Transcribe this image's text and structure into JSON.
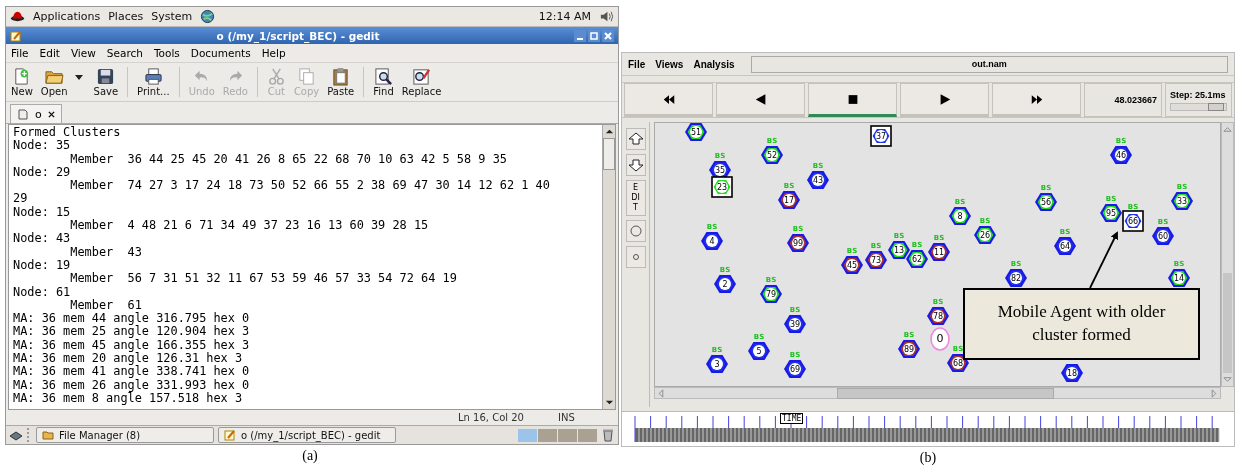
{
  "figure_a": {
    "top_panel": {
      "menus": [
        "Applications",
        "Places",
        "System"
      ],
      "clock": "12:14 AM"
    },
    "window": {
      "title": "o (/my_1/script_BEC) - gedit"
    },
    "menu_bar": [
      "File",
      "Edit",
      "View",
      "Search",
      "Tools",
      "Documents",
      "Help"
    ],
    "toolbar": [
      {
        "kind": "new",
        "label": "New",
        "disabled": false
      },
      {
        "kind": "open",
        "label": "Open",
        "disabled": false
      },
      {
        "kind": "dropdown",
        "disabled": false
      },
      {
        "kind": "save",
        "label": "Save",
        "disabled": false
      },
      {
        "kind": "separator"
      },
      {
        "kind": "print",
        "label": "Print...",
        "disabled": false
      },
      {
        "kind": "separator"
      },
      {
        "kind": "undo",
        "label": "Undo",
        "disabled": true
      },
      {
        "kind": "redo",
        "label": "Redo",
        "disabled": true
      },
      {
        "kind": "separator"
      },
      {
        "kind": "cut",
        "label": "Cut",
        "disabled": true
      },
      {
        "kind": "copy",
        "label": "Copy",
        "disabled": true
      },
      {
        "kind": "paste",
        "label": "Paste",
        "disabled": false
      },
      {
        "kind": "separator"
      },
      {
        "kind": "find",
        "label": "Find",
        "disabled": false
      },
      {
        "kind": "replace",
        "label": "Replace",
        "disabled": false
      }
    ],
    "tabs": [
      {
        "label": "o",
        "selected": true
      }
    ],
    "editor_lines": [
      "Formed Clusters",
      "Node: 35",
      "\tMember  36 44 25 45 20 41 26 8 65 22 68 70 10 63 42 5 58 9 35",
      "Node: 29",
      "\tMember  74 27 3 17 24 18 73 50 52 66 55 2 38 69 47 30 14 12 62 1 40",
      "29",
      "Node: 15",
      "\tMember  4 48 21 6 71 34 49 37 23 16 13 60 39 28 15",
      "Node: 43",
      "\tMember  43",
      "Node: 19",
      "\tMember  56 7 31 51 32 11 67 53 59 46 57 33 54 72 64 19",
      "Node: 61",
      "\tMember  61",
      "MA: 36 mem 44 angle 316.795 hex 0",
      "MA: 36 mem 25 angle 120.904 hex 3",
      "MA: 36 mem 45 angle 166.355 hex 3",
      "MA: 36 mem 20 angle 126.31 hex 3",
      "MA: 36 mem 41 angle 338.741 hex 0",
      "MA: 36 mem 26 angle 331.993 hex 0",
      "MA: 36 mem 8 angle 157.518 hex 3"
    ],
    "status_bar": {
      "position": "Ln 16, Col 20",
      "mode": "INS"
    },
    "taskbar": {
      "items": [
        {
          "kind": "folder",
          "label": "File Manager (8)"
        },
        {
          "kind": "editor",
          "label": "o (/my_1/script_BEC) - gedit"
        }
      ],
      "workspaces": [
        {
          "selected": true
        },
        {
          "selected": false
        },
        {
          "selected": false
        },
        {
          "selected": false
        }
      ]
    },
    "caption": "(a)"
  },
  "figure_b": {
    "menu_bar": [
      "File",
      "Views",
      "Analysis"
    ],
    "file_name": "out.nam",
    "playback_buttons": [
      {
        "kind": "rewind",
        "selected": false
      },
      {
        "kind": "back",
        "selected": false
      },
      {
        "kind": "stop",
        "selected": true
      },
      {
        "kind": "play",
        "selected": false
      },
      {
        "kind": "fast_forward",
        "selected": false
      }
    ],
    "time": "48.023667",
    "step": {
      "label": "Step: 25.1ms",
      "level": 0.8
    },
    "tools": [
      {
        "kind": "zoom_in"
      },
      {
        "kind": "zoom_out"
      },
      {
        "kind": "edit",
        "label": "EDIT"
      },
      {
        "kind": "circle"
      },
      {
        "kind": "small_circle"
      }
    ],
    "nodes": [
      {
        "label": "51",
        "kind": "hexagon",
        "color": "#22dd22"
      },
      {
        "label": "37",
        "kind": "square",
        "color": "#2233ee"
      },
      {
        "label": "52",
        "kind": "hexagon",
        "color": "#22dd22",
        "tag": "BS"
      },
      {
        "label": "46",
        "kind": "hexagon",
        "color": "#2233ee",
        "tag": "BS"
      },
      {
        "label": "35",
        "kind": "hexagon",
        "color": "#2233ee",
        "tag": "BS"
      },
      {
        "label": "43",
        "kind": "hexagon",
        "color": "#2233ee",
        "tag": "BS"
      },
      {
        "label": "23",
        "kind": "square",
        "color": "#22dd22"
      },
      {
        "label": "17",
        "kind": "hexagon",
        "color": "#aa3333",
        "tag": "BS"
      },
      {
        "label": "8",
        "kind": "hexagon",
        "color": "#22dd22",
        "tag": "BS"
      },
      {
        "label": "56",
        "kind": "hexagon",
        "color": "#22dd22",
        "tag": "BS"
      },
      {
        "label": "95",
        "kind": "hexagon",
        "color": "#22dd22",
        "tag": "BS"
      },
      {
        "label": "66",
        "kind": "square",
        "color": "#2233ee",
        "tag": "BS"
      },
      {
        "label": "33",
        "kind": "hexagon",
        "color": "#22dd22",
        "tag": "BS"
      },
      {
        "label": "4",
        "kind": "hexagon",
        "color": "#2233ee",
        "tag": "BS"
      },
      {
        "label": "99",
        "kind": "hexagon",
        "color": "#aa3333",
        "tag": "BS"
      },
      {
        "label": "26",
        "kind": "hexagon",
        "color": "#22dd22",
        "tag": "BS"
      },
      {
        "label": "64",
        "kind": "hexagon",
        "color": "#2233ee",
        "tag": "BS"
      },
      {
        "label": "60",
        "kind": "hexagon",
        "color": "#2233ee",
        "tag": "BS"
      },
      {
        "label": "13",
        "kind": "hexagon",
        "color": "#22dd22",
        "tag": "BS"
      },
      {
        "label": "62",
        "kind": "hexagon",
        "color": "#22dd22",
        "tag": "BS"
      },
      {
        "label": "11",
        "kind": "hexagon",
        "color": "#aa3333",
        "tag": "BS"
      },
      {
        "label": "73",
        "kind": "hexagon",
        "color": "#aa3333",
        "tag": "BS"
      },
      {
        "label": "45",
        "kind": "hexagon",
        "color": "#aa3333",
        "tag": "BS"
      },
      {
        "label": "2",
        "kind": "hexagon",
        "color": "#2233ee",
        "tag": "BS"
      },
      {
        "label": "79",
        "kind": "hexagon",
        "color": "#22dd22",
        "tag": "BS"
      },
      {
        "label": "82",
        "kind": "hexagon",
        "color": "#2233ee",
        "tag": "BS"
      },
      {
        "label": "14",
        "kind": "hexagon",
        "color": "#22dd22",
        "tag": "BS"
      },
      {
        "label": "78",
        "kind": "hexagon",
        "color": "#aa3333",
        "tag": "BS"
      },
      {
        "label": "0",
        "kind": "circle",
        "color": "#ee88dd"
      },
      {
        "label": "39",
        "kind": "hexagon",
        "color": "#2233ee",
        "tag": "BS"
      },
      {
        "label": "5",
        "kind": "hexagon",
        "color": "#2233ee",
        "tag": "BS"
      },
      {
        "label": "89",
        "kind": "hexagon",
        "color": "#aa3333",
        "tag": "BS"
      },
      {
        "label": "3",
        "kind": "hexagon",
        "color": "#2233ee",
        "tag": "BS"
      },
      {
        "label": "69",
        "kind": "hexagon",
        "color": "#2233ee",
        "tag": "BS"
      },
      {
        "label": "68",
        "kind": "hexagon",
        "color": "#aa3333",
        "tag": "BS"
      },
      {
        "label": "18",
        "kind": "hexagon",
        "color": "#2233ee"
      }
    ],
    "callout": "Mobile Agent with older cluster formed",
    "timeline_label": "TIME",
    "caption": "(b)"
  }
}
